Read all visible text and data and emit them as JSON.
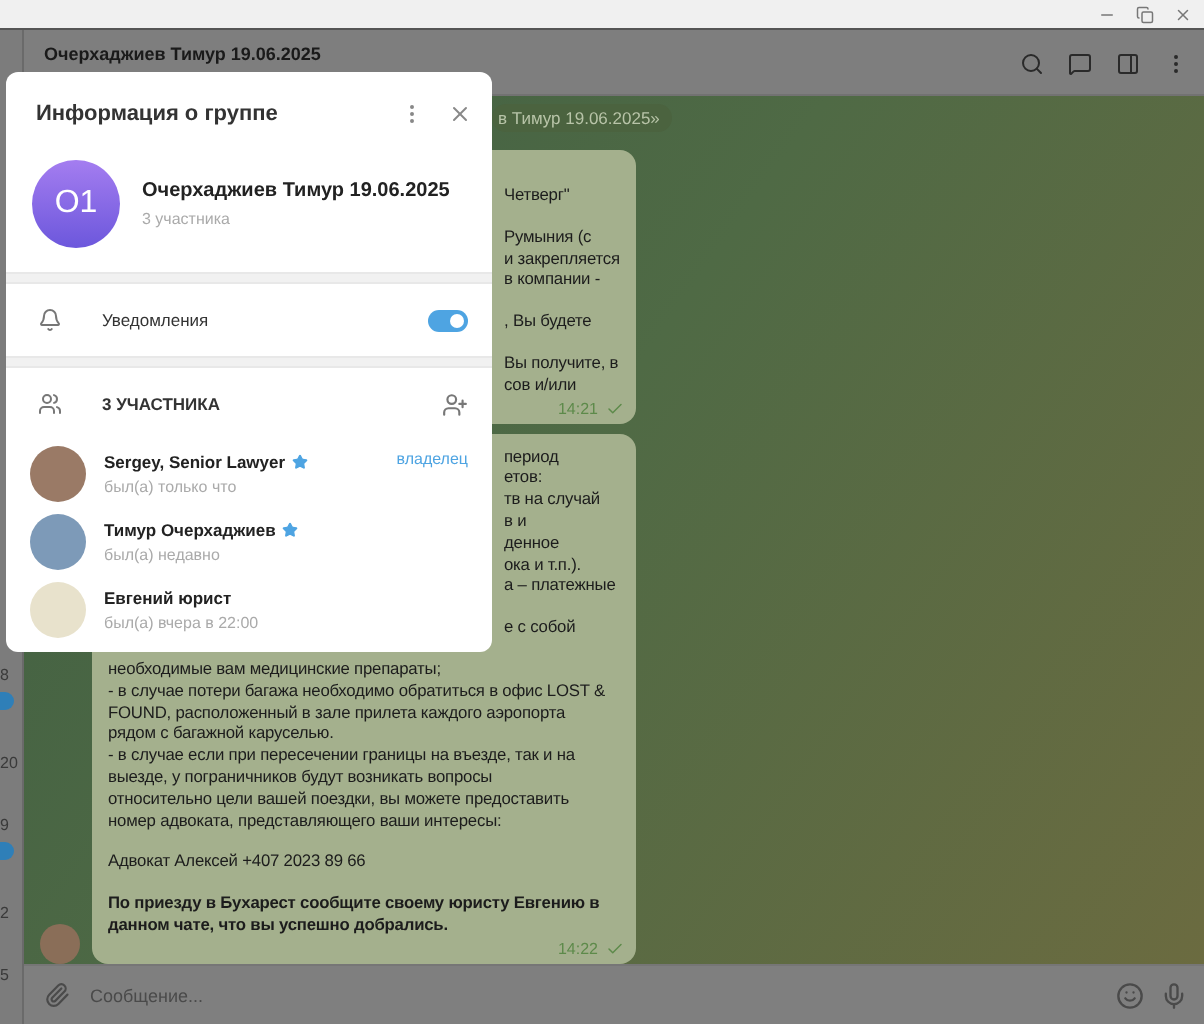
{
  "sidebar_fragments": [
    {
      "text": "8",
      "badge": true
    },
    {
      "text": "20",
      "badge": false
    },
    {
      "text": "9",
      "badge": true
    },
    {
      "text": "2",
      "badge": false
    },
    {
      "text": "5",
      "badge": false
    }
  ],
  "chat": {
    "title": "Очерхаджиев Тимур 19.06.2025",
    "pinned_pill": "в Тимур 19.06.2025»",
    "messages": [
      {
        "avatar": false,
        "time": "14:21",
        "read": true,
        "paragraphs": [
          {
            "kind": "partial",
            "lines": [
              "Четверг\""
            ]
          },
          {
            "kind": "partial",
            "lines": [
              "Румыния (с",
              "и закрепляется",
              "в компании -"
            ]
          },
          {
            "kind": "partial",
            "lines": [
              ", Вы будете"
            ]
          },
          {
            "kind": "partial",
            "lines": [
              "Вы получите, в",
              "сов и/или"
            ]
          }
        ]
      },
      {
        "avatar": true,
        "time": "14:22",
        "read": true,
        "paragraphs": [
          {
            "kind": "partial",
            "lines": [
              "период",
              "етов:",
              "тв на случай",
              "в и",
              "денное",
              "ока и т.п.).",
              "а – платежные"
            ]
          },
          {
            "kind": "partial",
            "lines": [
              "е с собой"
            ]
          },
          {
            "kind": "full",
            "lines": [
              "необходимые вам медицинские препараты;",
              "- в случае потери багажа необходимо обратиться в офис LOST &",
              "FOUND, расположенный в зале прилета каждого аэропорта",
              "рядом с багажной каруселью.",
              "- в случае если при пересечении границы на въезде, так и на",
              "выезде, у пограничников будут возникать вопросы",
              "относительно цели вашей поездки, вы можете предоставить",
              "номер адвоката, представляющего ваши интересы:"
            ]
          },
          {
            "kind": "full",
            "lines": [
              "Адвокат Алексей +407 2023 89 66"
            ]
          },
          {
            "kind": "bold",
            "lines": [
              "По приезду в Бухарест сообщите своему юристу Евгению в",
              "данном чате, что вы успешно добрались."
            ]
          }
        ]
      }
    ],
    "composer": {
      "placeholder": "Сообщение..."
    }
  },
  "dialog": {
    "title": "Информация о группе",
    "group": {
      "initials": "О1",
      "name": "Очерхаджиев Тимур 19.06.2025",
      "subtitle": "3 участника"
    },
    "notifications": {
      "label": "Уведомления",
      "on": true
    },
    "members_header": "3 УЧАСТНИКА",
    "members": [
      {
        "name": "Sergey, Senior Lawyer",
        "status": "был(а) только что",
        "starred": true,
        "role": "владелец"
      },
      {
        "name": "Тимур Очерхаджиев",
        "status": "был(а) недавно",
        "starred": true
      },
      {
        "name": "Евгений юрист",
        "status": "был(а) вчера в 22:00",
        "starred": false
      }
    ]
  }
}
